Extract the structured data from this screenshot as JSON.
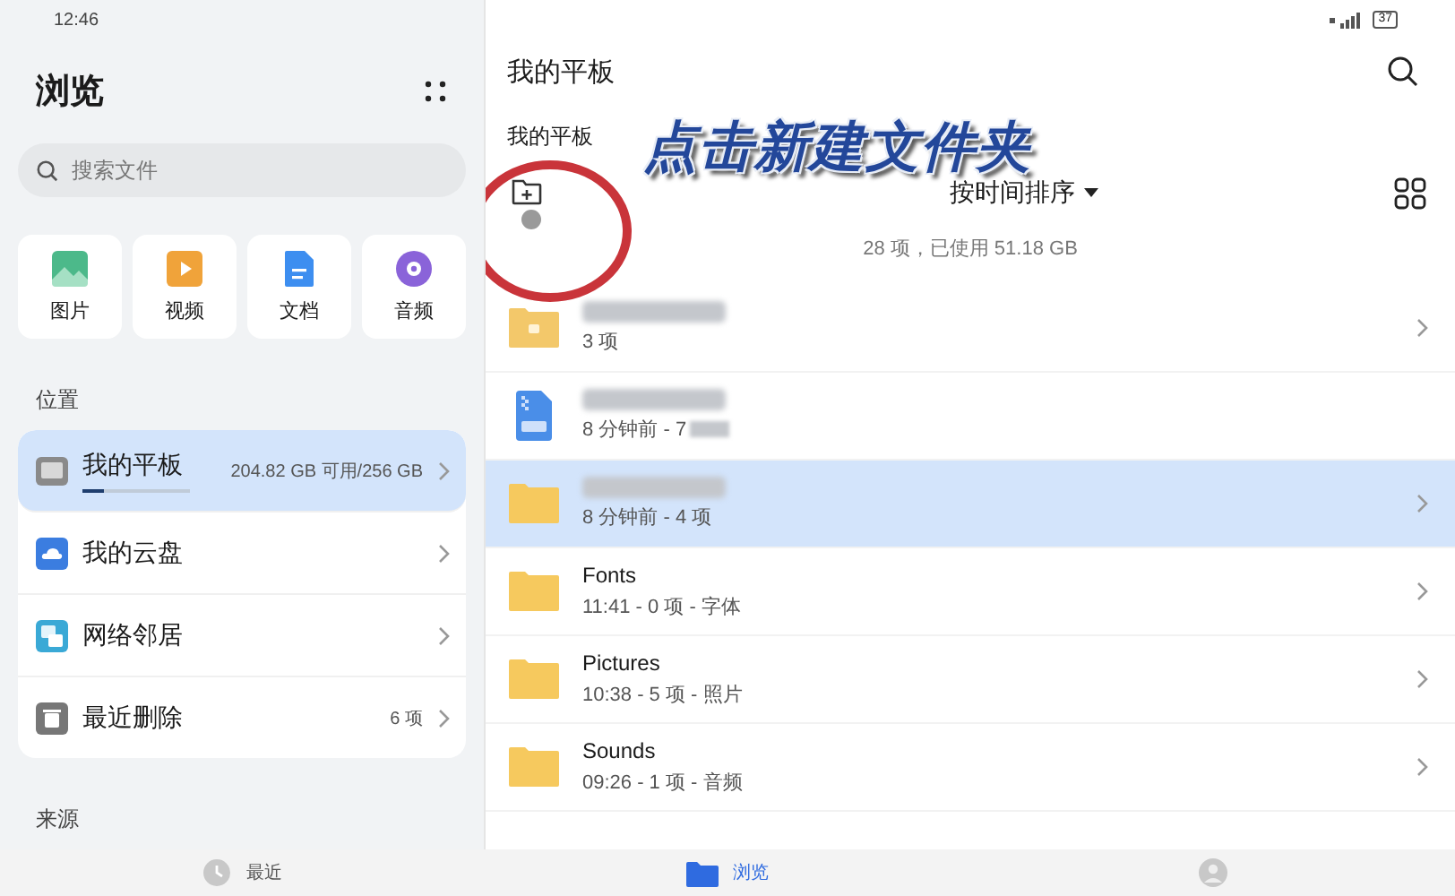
{
  "status_bar": {
    "time": "12:46",
    "battery": "37"
  },
  "sidebar": {
    "title": "浏览",
    "search": {
      "placeholder": "搜索文件"
    },
    "categories": [
      {
        "label": "图片",
        "kind": "image"
      },
      {
        "label": "视频",
        "kind": "video"
      },
      {
        "label": "文档",
        "kind": "document"
      },
      {
        "label": "音频",
        "kind": "audio"
      }
    ],
    "locations_heading": "位置",
    "locations": [
      {
        "label": "我的平板",
        "detail": "204.82 GB 可用/256 GB",
        "kind": "tablet",
        "selected": true,
        "level": 0.2
      },
      {
        "label": "我的云盘",
        "kind": "cloud",
        "selected": false
      },
      {
        "label": "网络邻居",
        "kind": "network",
        "selected": false
      },
      {
        "label": "最近删除",
        "detail": "6 项",
        "kind": "trash",
        "selected": false
      }
    ],
    "sources_heading": "来源"
  },
  "main": {
    "title": "我的平板",
    "breadcrumb": "我的平板",
    "annotation": "点击新建文件夹",
    "sort": "按时间排序",
    "summary": "28 项，已使用 51.18 GB",
    "files": [
      {
        "redacted": true,
        "subtitle": "3 项",
        "kind": "app-folder",
        "selected": false,
        "subtitle_redacted": false
      },
      {
        "redacted": true,
        "subtitle": "8 分钟前 - 7",
        "kind": "zip",
        "selected": false,
        "subtitle_redacted": true
      },
      {
        "redacted": true,
        "subtitle": "8 分钟前 - 4 项",
        "kind": "folder",
        "selected": true,
        "subtitle_redacted": false
      },
      {
        "redacted": false,
        "name": "Fonts",
        "subtitle": "11:41 - 0 项 - 字体",
        "kind": "folder",
        "selected": false,
        "subtitle_redacted": false
      },
      {
        "redacted": false,
        "name": "Pictures",
        "subtitle": "10:38 - 5 项 - 照片",
        "kind": "folder",
        "selected": false,
        "subtitle_redacted": false
      },
      {
        "redacted": false,
        "name": "Sounds",
        "subtitle": "09:26 - 1 项 - 音频",
        "kind": "folder",
        "selected": false,
        "subtitle_redacted": false
      }
    ]
  },
  "bottom_nav": [
    {
      "label": "最近",
      "kind": "recent",
      "selected": false
    },
    {
      "label": "浏览",
      "kind": "browse",
      "selected": true
    },
    {
      "kind": "profile",
      "selected": false
    }
  ]
}
